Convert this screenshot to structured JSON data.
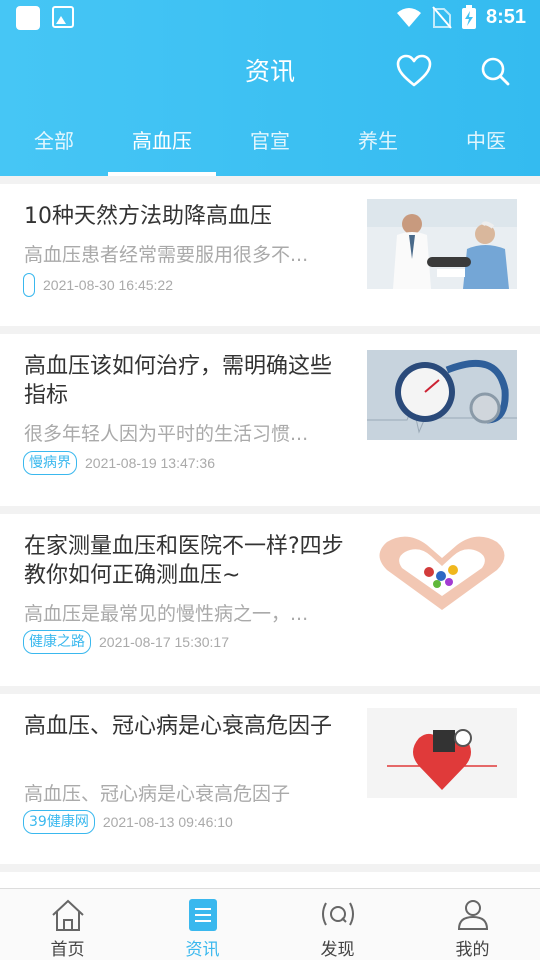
{
  "status": {
    "time": "8:51"
  },
  "header": {
    "title": "资讯",
    "tabs": [
      {
        "label": "全部",
        "active": false
      },
      {
        "label": "高血压",
        "active": true
      },
      {
        "label": "官宣",
        "active": false
      },
      {
        "label": "养生",
        "active": false
      },
      {
        "label": "中医",
        "active": false
      }
    ]
  },
  "articles": [
    {
      "title": "10种天然方法助降高血压",
      "desc": "高血压患者经常需要服用很多不...",
      "tag": "",
      "date": "2021-08-30 16:45:22",
      "image": "doctor-patient-photo"
    },
    {
      "title": "高血压该如何治疗，需明确这些指标",
      "desc": "很多年轻人因为平时的生活习惯...",
      "tag": "慢病界",
      "date": "2021-08-19 13:47:36",
      "image": "stethoscope-gauge-photo"
    },
    {
      "title": "在家测量血压和医院不一样?四步教你如何正确测血压~",
      "desc": "高血压是最常见的慢性病之一，...",
      "tag": "健康之路",
      "date": "2021-08-17 15:30:17",
      "image": "heart-hands-pills-photo"
    },
    {
      "title": "高血压、冠心病是心衰高危因子",
      "desc": "高血压、冠心病是心衰高危因子",
      "tag": "39健康网",
      "date": "2021-08-13 09:46:10",
      "image": "heart-monitor-illustration"
    }
  ],
  "bottom_nav": [
    {
      "label": "首页",
      "icon": "home-icon",
      "active": false
    },
    {
      "label": "资讯",
      "icon": "news-icon",
      "active": true
    },
    {
      "label": "发现",
      "icon": "discover-icon",
      "active": false
    },
    {
      "label": "我的",
      "icon": "profile-icon",
      "active": false
    }
  ],
  "colors": {
    "accent": "#3ab8ee",
    "header": "#40c2f4"
  }
}
